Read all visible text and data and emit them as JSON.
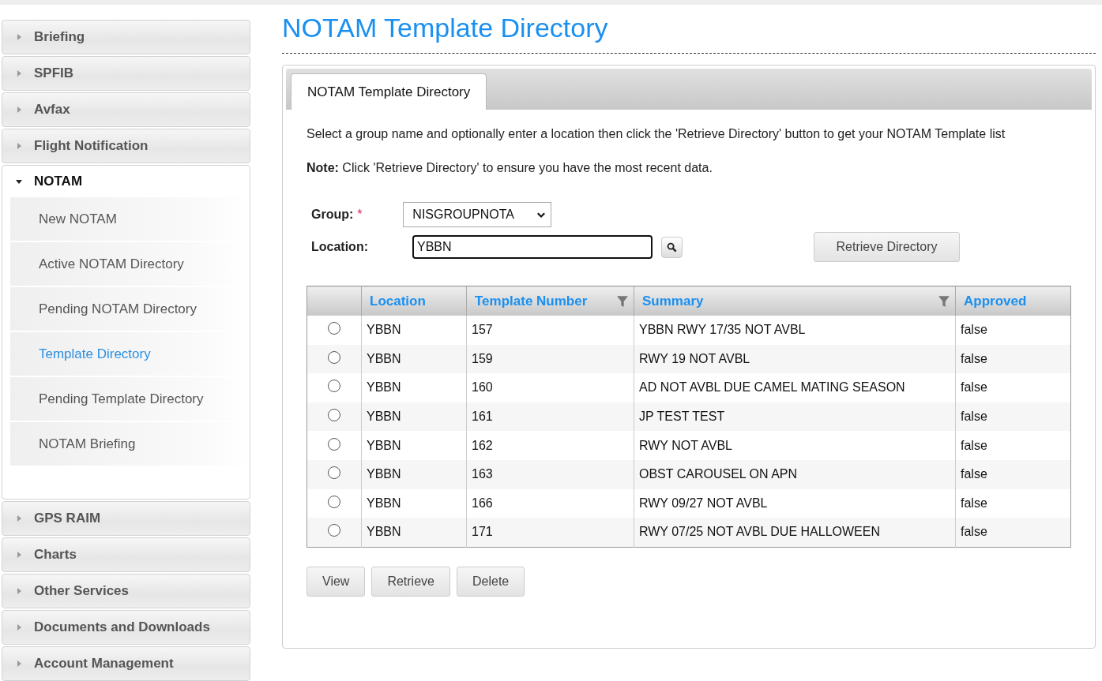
{
  "sidebar": {
    "sections": [
      {
        "label": "Briefing",
        "expanded": false
      },
      {
        "label": "SPFIB",
        "expanded": false
      },
      {
        "label": "Avfax",
        "expanded": false
      },
      {
        "label": "Flight Notification",
        "expanded": false
      },
      {
        "label": "NOTAM",
        "expanded": true,
        "children": [
          {
            "label": "New NOTAM",
            "selected": false
          },
          {
            "label": "Active NOTAM Directory",
            "selected": false
          },
          {
            "label": "Pending NOTAM Directory",
            "selected": false
          },
          {
            "label": "Template Directory",
            "selected": true
          },
          {
            "label": "Pending Template Directory",
            "selected": false
          },
          {
            "label": "NOTAM Briefing",
            "selected": false
          }
        ]
      },
      {
        "label": "GPS RAIM",
        "expanded": false
      },
      {
        "label": "Charts",
        "expanded": false
      },
      {
        "label": "Other Services",
        "expanded": false
      },
      {
        "label": "Documents and Downloads",
        "expanded": false
      },
      {
        "label": "Account Management",
        "expanded": false
      }
    ]
  },
  "page_title": "NOTAM Template Directory",
  "tabs": [
    {
      "label": "NOTAM Template Directory",
      "selected": true
    }
  ],
  "intro": "Select a group name and optionally enter a location then click the 'Retrieve Directory' button to get your NOTAM Template list",
  "note": "**Note:** Click 'Retrieve Directory' to ensure you have the most recent data.",
  "form": {
    "group_label": "Group:",
    "required_mark": "*",
    "group_value": "NISGROUPNOTA",
    "location_label": "Location:",
    "location_value": "YBBN",
    "retrieve_button": "Retrieve Directory"
  },
  "table": {
    "columns": [
      {
        "label": "Location",
        "filter": false
      },
      {
        "label": "Template Number",
        "filter": true
      },
      {
        "label": "Summary",
        "filter": true
      },
      {
        "label": "Approved",
        "filter": false
      }
    ],
    "rows": [
      {
        "selected": false,
        "cells": [
          "YBBN",
          "157",
          "YBBN RWY 17/35 NOT AVBL",
          "false"
        ]
      },
      {
        "selected": false,
        "cells": [
          "YBBN",
          "159",
          "RWY 19 NOT AVBL",
          "false"
        ]
      },
      {
        "selected": false,
        "cells": [
          "YBBN",
          "160",
          "AD NOT AVBL DUE CAMEL MATING SEASON",
          "false"
        ]
      },
      {
        "selected": false,
        "cells": [
          "YBBN",
          "161",
          "JP TEST TEST",
          "false"
        ]
      },
      {
        "selected": false,
        "cells": [
          "YBBN",
          "162",
          "RWY NOT AVBL",
          "false"
        ]
      },
      {
        "selected": false,
        "cells": [
          "YBBN",
          "163",
          "OBST CAROUSEL ON APN",
          "false"
        ]
      },
      {
        "selected": false,
        "cells": [
          "YBBN",
          "166",
          "RWY 09/27 NOT AVBL",
          "false"
        ]
      },
      {
        "selected": false,
        "cells": [
          "YBBN",
          "171",
          "RWY 07/25 NOT AVBL DUE HALLOWEEN",
          "false"
        ]
      }
    ]
  },
  "buttons": [
    "View",
    "Retrieve",
    "Delete"
  ]
}
